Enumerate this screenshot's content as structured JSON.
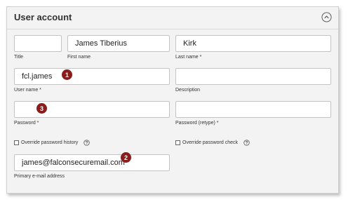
{
  "panel": {
    "title": "User account"
  },
  "fields": {
    "title": {
      "value": "",
      "label": "Title"
    },
    "first_name": {
      "value": "James Tiberius",
      "label": "First name"
    },
    "last_name": {
      "value": "Kirk",
      "label": "Last name *"
    },
    "user_name": {
      "value": "fcl.james",
      "label": "User name *"
    },
    "description": {
      "value": "",
      "label": "Description"
    },
    "password": {
      "value": "",
      "label": "Password *"
    },
    "password_retype": {
      "value": "",
      "label": "Password (retype) *"
    },
    "email": {
      "value": "james@falconsecuremail.com",
      "label": "Primary e-mail address"
    }
  },
  "checkboxes": {
    "override_history": {
      "label": "Override password history",
      "checked": false
    },
    "override_check": {
      "label": "Override password check",
      "checked": false
    }
  },
  "markers": {
    "user_name": "1",
    "email": "2",
    "password": "3"
  },
  "colors": {
    "marker": "#8b1c1c",
    "panel_bg": "#f3f3f3",
    "field_border": "#c4c4c4"
  },
  "icons": {
    "collapse": "chevron-up-circle-icon",
    "help": "help-circle-icon"
  }
}
